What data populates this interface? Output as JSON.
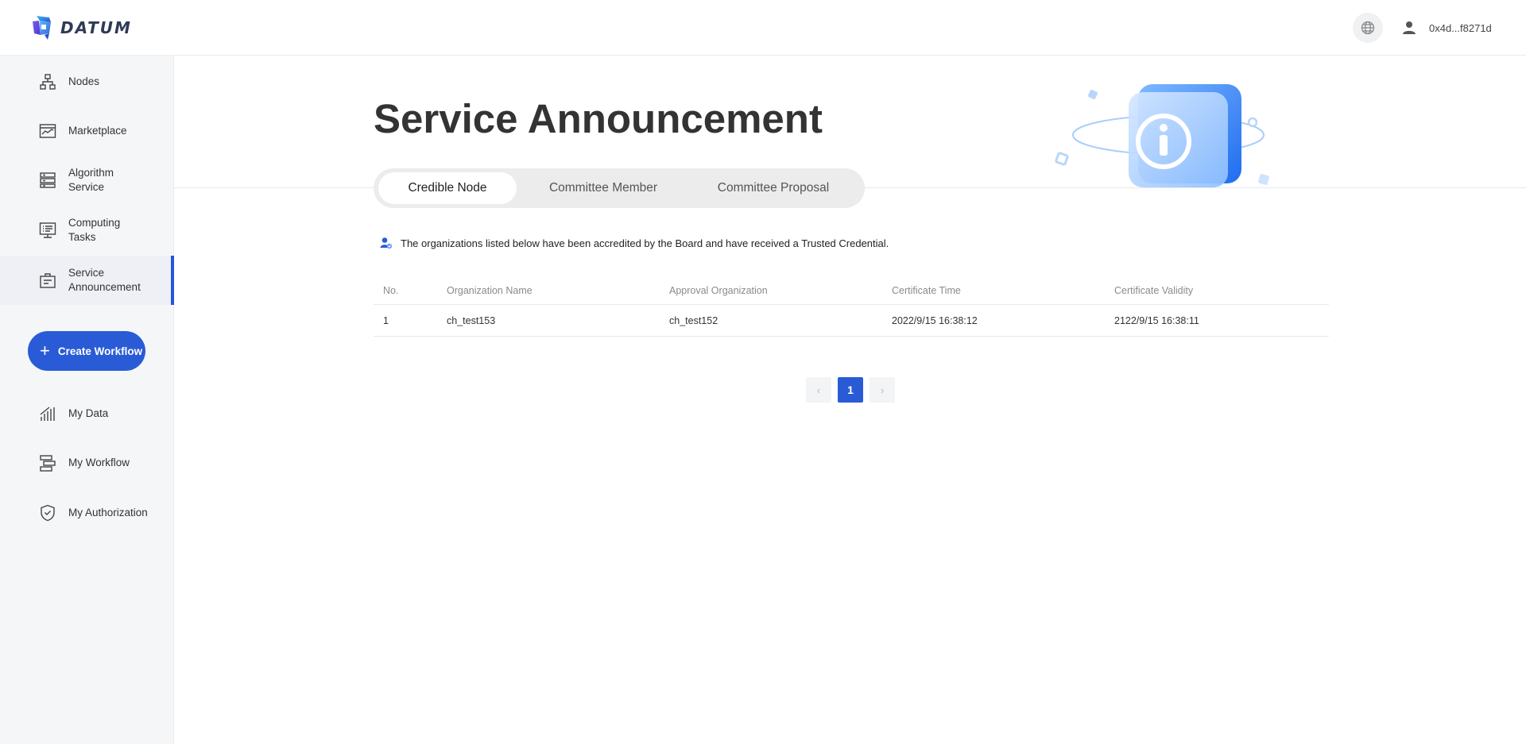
{
  "brand": {
    "name": "DATUM",
    "accent": "#2a5bd7"
  },
  "header": {
    "language_icon": "globe-icon",
    "user_icon": "user-icon",
    "wallet_address": "0x4d...f8271d"
  },
  "sidebar": {
    "items_top": [
      {
        "label": "Nodes",
        "icon": "nodes-icon"
      },
      {
        "label": "Marketplace",
        "icon": "marketplace-icon"
      },
      {
        "label": "Algorithm Service",
        "icon": "server-icon"
      },
      {
        "label": "Computing Tasks",
        "icon": "monitor-list-icon"
      },
      {
        "label": "Service Announcement",
        "icon": "announcement-icon",
        "active": true
      }
    ],
    "create_button": "Create Workflow",
    "items_bottom": [
      {
        "label": "My Data",
        "icon": "data-chart-icon"
      },
      {
        "label": "My Workflow",
        "icon": "workflow-icon"
      },
      {
        "label": "My Authorization",
        "icon": "shield-check-icon"
      }
    ]
  },
  "main": {
    "title": "Service Announcement",
    "tabs": [
      {
        "label": "Credible Node",
        "active": true
      },
      {
        "label": "Committee Member",
        "active": false
      },
      {
        "label": "Committee Proposal",
        "active": false
      }
    ],
    "notice": "The organizations listed below have been accredited by the Board and have received a Trusted Credential.",
    "table": {
      "columns": [
        "No.",
        "Organization Name",
        "Approval Organization",
        "Certificate Time",
        "Certificate Validity"
      ],
      "rows": [
        [
          "1",
          "ch_test153",
          "ch_test152",
          "2022/9/15 16:38:12",
          "2122/9/15 16:38:11"
        ]
      ]
    },
    "pagination": {
      "prev": "‹",
      "current": "1",
      "next": "›"
    }
  }
}
